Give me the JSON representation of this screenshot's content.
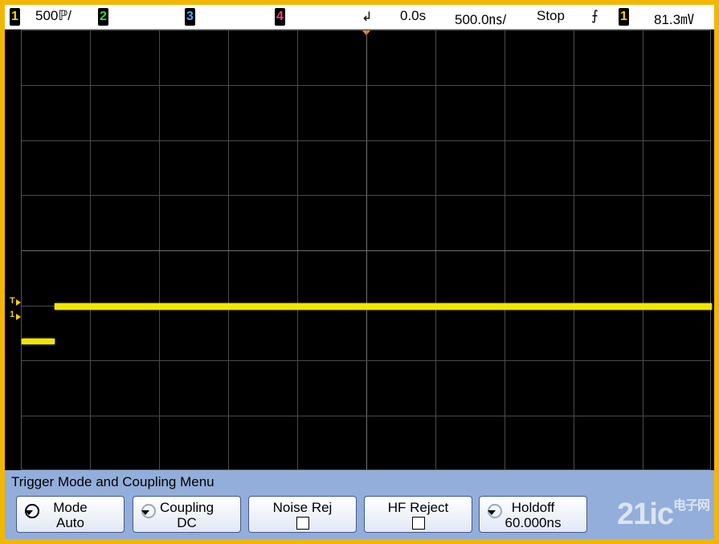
{
  "status": {
    "ch1_num": "1",
    "ch1_scale": "500ℙ/",
    "ch2_num": "2",
    "ch3_num": "3",
    "ch4_num": "4",
    "trig_pos_symbol": "↲",
    "delay": "0.0s",
    "timebase": "500.0㎱/",
    "run_state": "Stop",
    "trig_edge_symbol": "⨍",
    "trig_source": "1",
    "trig_level": "81.3㎷"
  },
  "indicators": {
    "trigger_marker": "T",
    "channel_marker": "1"
  },
  "menu": {
    "title": "Trigger Mode and Coupling Menu",
    "softkeys": [
      {
        "top": "Mode",
        "bottom": "Auto",
        "icon": "rotate-icon"
      },
      {
        "top": "Coupling",
        "bottom": "DC",
        "icon": "rotate-icon"
      },
      {
        "top": "Noise Rej",
        "bottom": "",
        "icon": "checkbox"
      },
      {
        "top": "HF Reject",
        "bottom": "",
        "icon": "checkbox"
      },
      {
        "top": "Holdoff",
        "bottom": "60.000ns",
        "icon": "rotate-icon"
      }
    ]
  },
  "watermark": {
    "text": "21ic",
    "sub": "电子网"
  },
  "colors": {
    "frame": "#f2b705",
    "trace": "#f2e600",
    "menu": "#93aeda",
    "ch1": "#f2d400",
    "ch2": "#3cd13c",
    "ch3": "#5aa2ff",
    "ch4": "#ff3a8a"
  }
}
